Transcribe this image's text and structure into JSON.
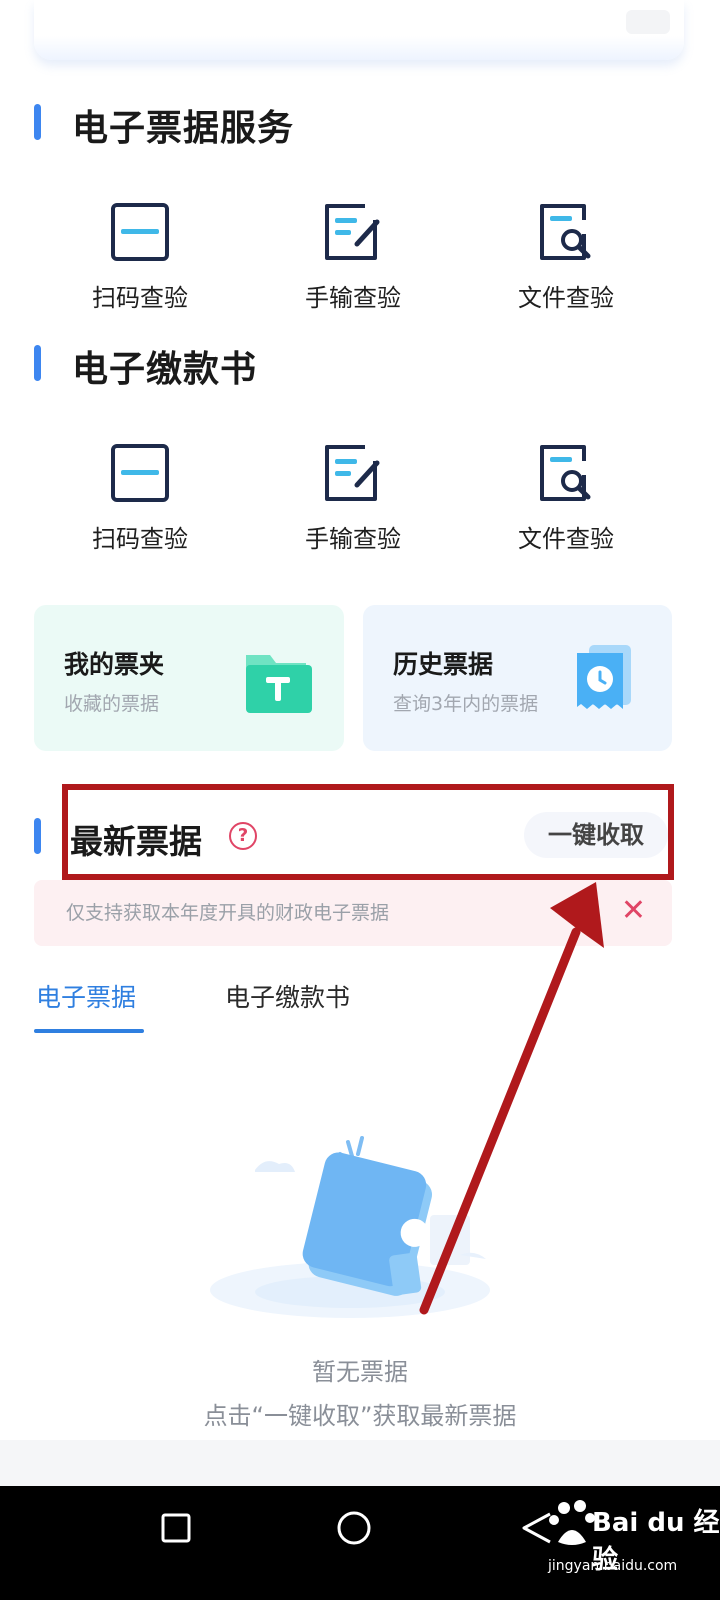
{
  "sections": [
    {
      "title": "电子票据服务",
      "items": [
        {
          "label": "扫码查验",
          "icon": "scan-frame-icon"
        },
        {
          "label": "手输查验",
          "icon": "edit-form-icon"
        },
        {
          "label": "文件查验",
          "icon": "file-search-icon"
        }
      ]
    },
    {
      "title": "电子缴款书",
      "items": [
        {
          "label": "扫码查验",
          "icon": "scan-frame-icon"
        },
        {
          "label": "手输查验",
          "icon": "edit-form-icon"
        },
        {
          "label": "文件查验",
          "icon": "file-search-icon"
        }
      ]
    }
  ],
  "cards": {
    "my_folder": {
      "title": "我的票夹",
      "subtitle": "收藏的票据",
      "icon": "folder-icon",
      "color": "#2fd1a8"
    },
    "history": {
      "title": "历史票据",
      "subtitle": "查询3年内的票据",
      "icon": "clock-receipt-icon",
      "color": "#4ab0f5"
    }
  },
  "latest": {
    "title": "最新票据",
    "help_glyph": "?",
    "action_label": "一键收取",
    "notice": "仅支持获取本年度开具的财政电子票据",
    "notice_close": "✕"
  },
  "tabs": [
    {
      "label": "电子票据",
      "active": true
    },
    {
      "label": "电子缴款书",
      "active": false
    }
  ],
  "empty_state": {
    "line1": "暂无票据",
    "line2": "点击“一键收取”获取最新票据"
  },
  "colors": {
    "accent": "#3d86f0",
    "annotation_red": "#b0191c",
    "warning_pink": "#e04566"
  },
  "watermark": {
    "brand": "Bai du 经验",
    "url": "jingyan.baidu.com"
  }
}
